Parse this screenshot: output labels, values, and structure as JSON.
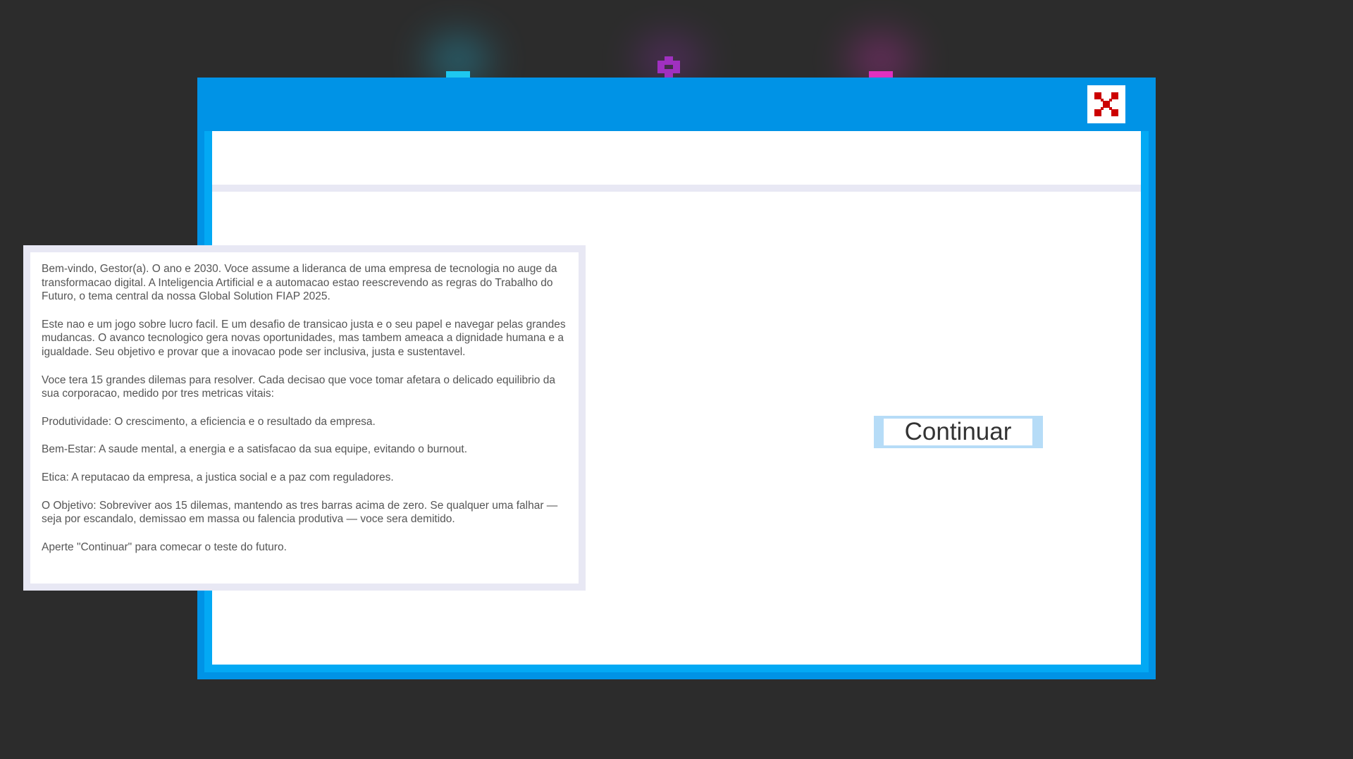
{
  "colors": {
    "background": "#2c2c2c",
    "window_frame": "#0093e6",
    "window_inner_frame": "#03a9f4",
    "panel_border": "#e8e8f4",
    "button_border": "#b6dcf7",
    "close_icon": "#cc0000",
    "deco_cyan": "#1ec8f0",
    "deco_purple": "#a030c0",
    "deco_magenta": "#e030c0"
  },
  "window": {
    "close_icon": "close-icon"
  },
  "intro": {
    "paragraphs": [
      "Bem-vindo, Gestor(a). O ano e 2030. Voce assume a lideranca de uma empresa de tecnologia no auge da transformacao digital. A Inteligencia Artificial e a automacao estao reescrevendo as regras do Trabalho do Futuro, o tema central da nossa Global Solution FIAP 2025.",
      "Este nao e um jogo sobre lucro facil. E um desafio de transicao justa e o seu papel e navegar pelas grandes mudancas. O avanco tecnologico gera novas oportunidades, mas tambem ameaca a dignidade humana e a igualdade. Seu objetivo e provar que a inovacao pode ser inclusiva, justa e sustentavel.",
      "Voce tera 15 grandes dilemas para resolver. Cada decisao que voce tomar afetara o delicado equilibrio da sua corporacao, medido por tres metricas vitais:",
      "Produtividade: O crescimento, a eficiencia e o resultado da empresa.",
      "Bem-Estar: A saude mental, a energia e a satisfacao da sua equipe, evitando o burnout.",
      "Etica: A reputacao da empresa, a justica social e a paz com reguladores.",
      "O Objetivo: Sobreviver aos 15 dilemas, mantendo as tres barras acima de zero. Se qualquer uma falhar — seja por escandalo, demissao em massa ou falencia produtiva — voce sera demitido.",
      "Aperte \"Continuar\" para comecar o teste do futuro."
    ]
  },
  "continue_button": {
    "label": "Continuar"
  }
}
